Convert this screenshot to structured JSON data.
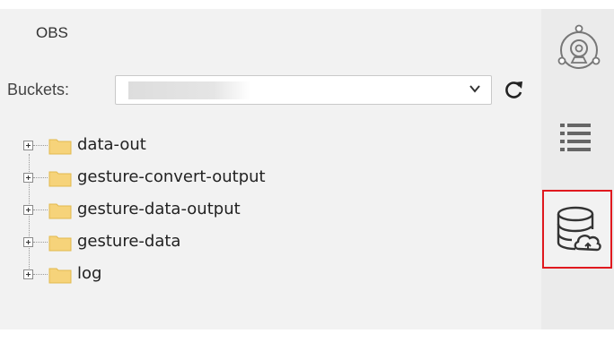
{
  "panel": {
    "title": "OBS",
    "buckets_label": "Buckets:",
    "bucket_select": {
      "value": ""
    }
  },
  "tree": {
    "items": [
      {
        "label": "data-out"
      },
      {
        "label": "gesture-convert-output"
      },
      {
        "label": "gesture-data-output"
      },
      {
        "label": "gesture-data"
      },
      {
        "label": "log"
      }
    ]
  },
  "sidebar": {
    "icons": [
      "camera-icon",
      "list-icon",
      "database-cloud-icon"
    ],
    "highlight_color": "#e0191f"
  },
  "colors": {
    "folder": "#f6d37a",
    "panel_bg": "#f2f2f2"
  }
}
